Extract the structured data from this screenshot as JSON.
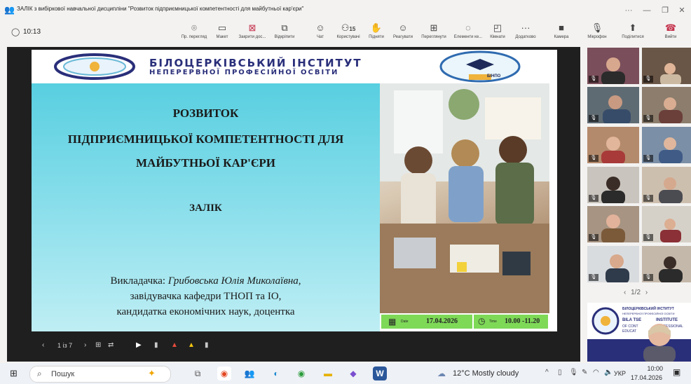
{
  "window": {
    "title": "ЗАЛІК з вибіркової навчальної дисципліни \"Розвиток підприємницької компетентності для майбутньої кар'єри\"",
    "more": "···"
  },
  "meeting": {
    "timer": "10:13"
  },
  "toolbar": {
    "items": [
      {
        "label": "Пр. перегляд",
        "icon": "⌾"
      },
      {
        "label": "Макет",
        "icon": "▭"
      },
      {
        "label": "Закрити дос...",
        "icon": "⊠"
      },
      {
        "label": "Відкріпити",
        "icon": "⧉"
      },
      {
        "label": "Чат",
        "icon": "☺"
      },
      {
        "label": "Користувачі",
        "icon": "⚇",
        "count": "15"
      },
      {
        "label": "Підняти",
        "icon": "✋"
      },
      {
        "label": "Реагувати",
        "icon": "☺"
      },
      {
        "label": "Переглянути",
        "icon": "⊞"
      },
      {
        "label": "Елементи ке...",
        "icon": "◌"
      },
      {
        "label": "Кімнати",
        "icon": "◰"
      },
      {
        "label": "Додатково",
        "icon": "···"
      },
      {
        "label": "Камера",
        "icon": "■"
      },
      {
        "label": "Мікрофон",
        "icon": "🎙"
      },
      {
        "label": "Поділитися",
        "icon": "⬆"
      },
      {
        "label": "Вийти",
        "icon": "☎"
      }
    ]
  },
  "slide": {
    "institute_line1": "БІЛОЦЕРКІВСЬКИЙ ІНСТИТУТ",
    "institute_line2": "НЕПЕРЕРВНОЇ ПРОФЕСІЙНОЇ ОСВІТИ",
    "title1": "РОЗВИТОК",
    "title2": "ПІДПРИЄМНИЦЬКОЇ КОМПЕТЕНТНОСТІ ДЛЯ",
    "title3": "МАЙБУТНЬОЇ КАР'ЄРИ",
    "subtitle": "ЗАЛІК",
    "teacher_label": "Викладачка: ",
    "teacher_name": "Грибовська Юлія Миколаївна",
    "teacher_comma": ",",
    "position1": "завідувачка кафедри ТНОП та ІО,",
    "position2": "кандидатка економічних наук, доцентка",
    "date_label": "Date",
    "date": "17.04.2026",
    "time_label": "Time",
    "time": "10.00 -11.20",
    "logo_banner": "БІНПО"
  },
  "slide_controls": {
    "page": "1 із 7"
  },
  "gallery": {
    "page": "1/2"
  },
  "shared_thumb": {
    "line1": "БІЛОЦЕРКІВСЬКИЙ ІНСТИТУТ",
    "line2": "НЕПЕРЕРВНОЇ ПРОФЕСІЙНОЇ ОСВІТИ",
    "line3": "BILA TSE",
    "line4": "INSTITUTE",
    "line5": "OF CONT",
    "line6": "PROFESSIONAL",
    "line7": "EDUCAT"
  },
  "taskbar": {
    "search": "Пошук",
    "weather": "12°C  Mostly cloudy",
    "lang": "УКР",
    "clock_time": "10:00",
    "clock_date": "17.04.2026"
  },
  "colors": {
    "teal": "#5ecfe0",
    "green": "#7ed957",
    "accent": "#5b5fc7",
    "leave": "#c4314b"
  }
}
